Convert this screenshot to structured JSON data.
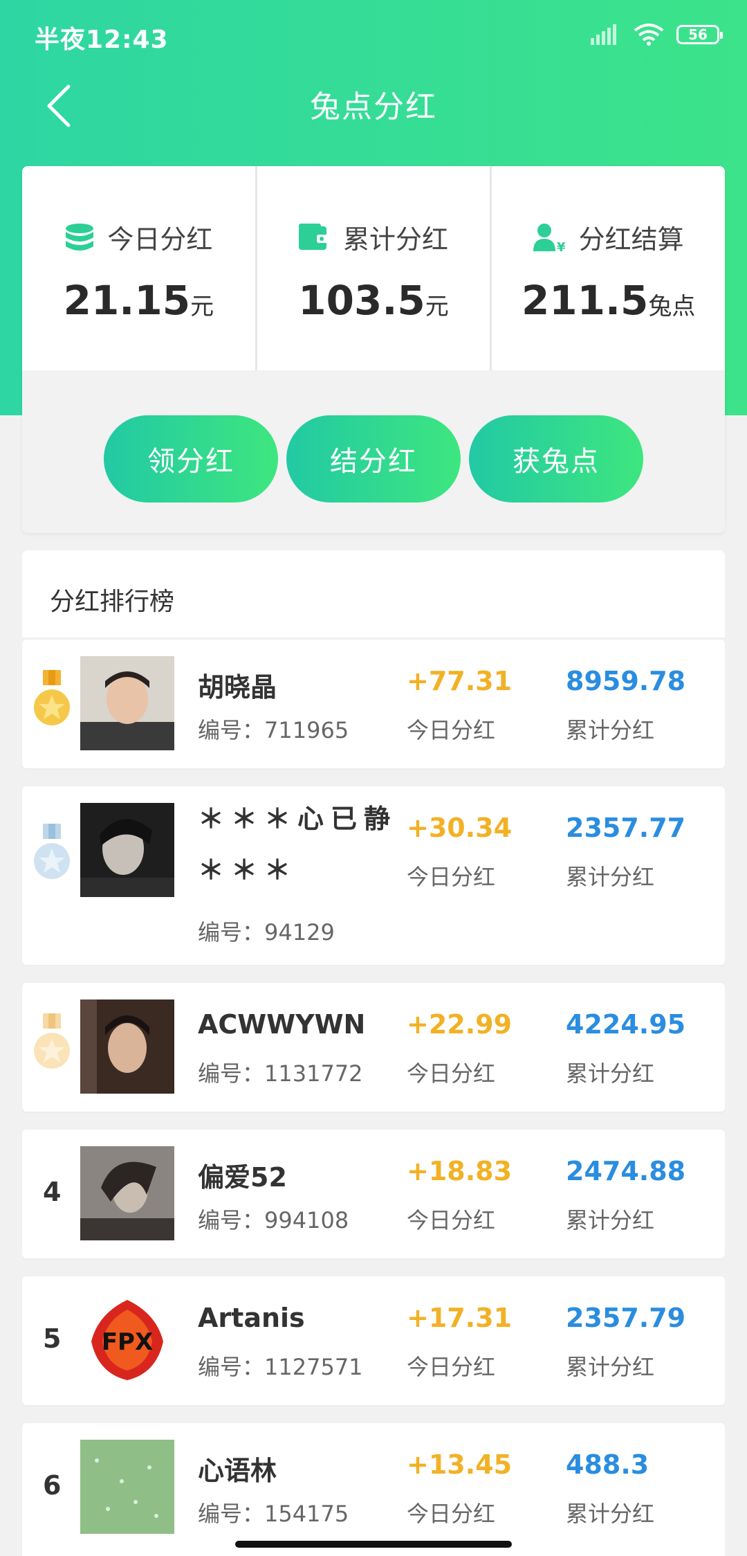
{
  "status_bar": {
    "time": "半夜12:43",
    "battery": "56"
  },
  "nav": {
    "title": "兔点分红",
    "back_icon": "chevron-left-icon"
  },
  "stats": [
    {
      "label": "今日分红",
      "value": "21.15",
      "unit": "元",
      "icon": "coins-stack-icon"
    },
    {
      "label": "累计分红",
      "value": "103.5",
      "unit": "元",
      "icon": "wallet-icon"
    },
    {
      "label": "分红结算",
      "value": "211.5",
      "unit": "兔点",
      "icon": "user-yen-icon"
    }
  ],
  "actions": [
    {
      "label": "领分红"
    },
    {
      "label": "结分红"
    },
    {
      "label": "获兔点"
    }
  ],
  "ranking": {
    "title": "分红排行榜",
    "uid_prefix": "编号：",
    "today_label": "今日分红",
    "total_label": "累计分红",
    "items": [
      {
        "rank": "1",
        "name": "胡晓晶",
        "uid": "711965",
        "today": "+77.31",
        "total": "8959.78"
      },
      {
        "rank": "2",
        "name": "＊＊＊心已静＊＊＊",
        "uid": "94129",
        "today": "+30.34",
        "total": "2357.77"
      },
      {
        "rank": "3",
        "name": "ACWWYWN",
        "uid": "1131772",
        "today": "+22.99",
        "total": "4224.95"
      },
      {
        "rank": "4",
        "name": "偏爱52",
        "uid": "994108",
        "today": "+18.83",
        "total": "2474.88"
      },
      {
        "rank": "5",
        "name": "Artanis",
        "uid": "1127571",
        "today": "+17.31",
        "total": "2357.79"
      },
      {
        "rank": "6",
        "name": "心语林",
        "uid": "154175",
        "today": "+13.45",
        "total": "488.3"
      }
    ]
  },
  "colors": {
    "accent": "#2ed6a3",
    "today": "#f2b125",
    "total": "#2a8de0"
  }
}
